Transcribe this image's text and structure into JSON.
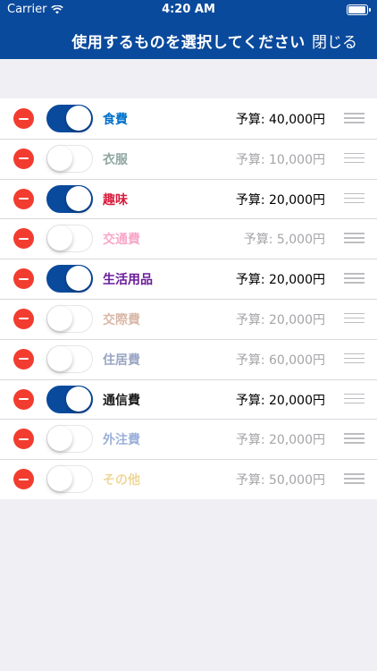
{
  "status": {
    "carrier": "Carrier",
    "time": "4:20 AM"
  },
  "nav": {
    "title": "使用するものを選択してください",
    "close_label": "閉じる"
  },
  "colors": {
    "accent": "#0a4a9c",
    "delete": "#f23c30"
  },
  "items": [
    {
      "label": "食費",
      "budget": "予算: 40,000円",
      "enabled": true,
      "color": "#0070c9"
    },
    {
      "label": "衣服",
      "budget": "予算: 10,000円",
      "enabled": false,
      "color": "#8ea6a0"
    },
    {
      "label": "趣味",
      "budget": "予算: 20,000円",
      "enabled": true,
      "color": "#d81b3c"
    },
    {
      "label": "交通費",
      "budget": "予算: 5,000円",
      "enabled": false,
      "color": "#f7a8c8"
    },
    {
      "label": "生活用品",
      "budget": "予算: 20,000円",
      "enabled": true,
      "color": "#6a1b9a"
    },
    {
      "label": "交際費",
      "budget": "予算: 20,000円",
      "enabled": false,
      "color": "#d9b8a8"
    },
    {
      "label": "住居費",
      "budget": "予算: 60,000円",
      "enabled": false,
      "color": "#9aa6c4"
    },
    {
      "label": "通信費",
      "budget": "予算: 20,000円",
      "enabled": true,
      "color": "#1a1a1a"
    },
    {
      "label": "外注費",
      "budget": "予算: 20,000円",
      "enabled": false,
      "color": "#9bb0d9"
    },
    {
      "label": "その他",
      "budget": "予算: 50,000円",
      "enabled": false,
      "color": "#eed79a"
    }
  ]
}
